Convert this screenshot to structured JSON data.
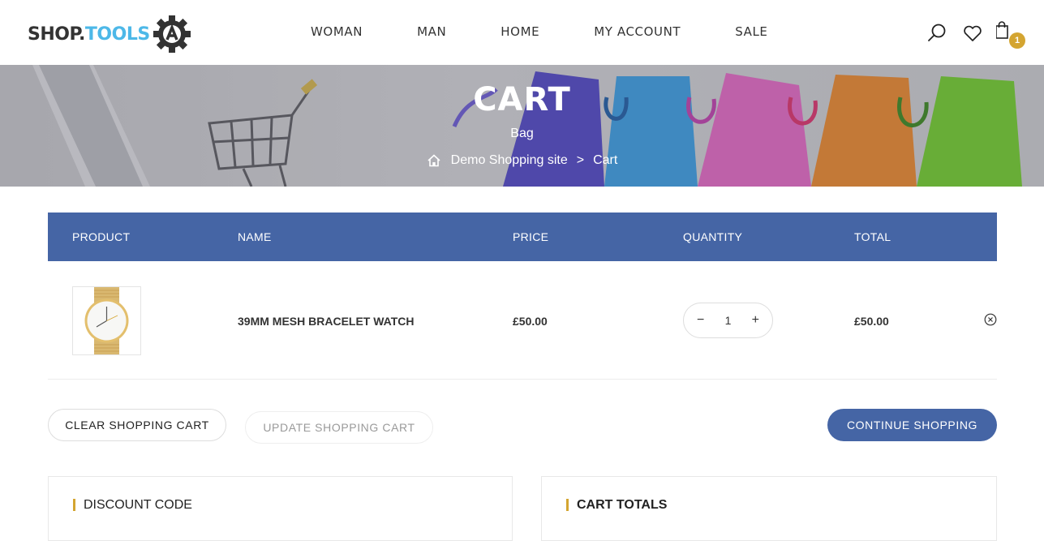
{
  "header": {
    "logo": {
      "part1": "SHOP.",
      "part2": "TOOLS"
    },
    "nav": [
      "WOMAN",
      "MAN",
      "HOME",
      "MY ACCOUNT",
      "SALE"
    ],
    "cart_count": "1"
  },
  "banner": {
    "title": "CART",
    "subtitle": "Bag",
    "breadcrumb": {
      "site": "Demo Shopping site",
      "separator": ">",
      "current": "Cart"
    }
  },
  "cart": {
    "headers": {
      "product": "PRODUCT",
      "name": "NAME",
      "price": "PRICE",
      "quantity": "QUANTITY",
      "total": "TOTAL"
    },
    "items": [
      {
        "name": "39MM MESH BRACELET WATCH",
        "price": "£50.00",
        "quantity": "1",
        "total": "£50.00"
      }
    ],
    "minus": "−",
    "plus": "+"
  },
  "actions": {
    "clear": "CLEAR SHOPPING CART",
    "update": "UPDATE SHOPPING CART",
    "continue": "CONTINUE SHOPPING"
  },
  "discount": {
    "title": "DISCOUNT CODE"
  },
  "totals": {
    "title": "CART TOTALS"
  },
  "colors": {
    "accent": "#4565a5",
    "badge": "#d4a531",
    "logo_accent": "#4db8e8"
  }
}
